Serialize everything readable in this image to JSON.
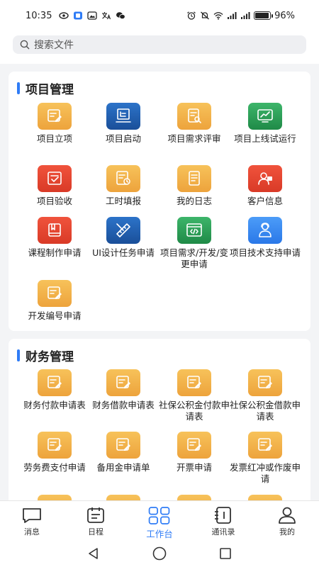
{
  "status": {
    "time": "10:35",
    "battery_text": "96%",
    "battery_level": 0.96
  },
  "search": {
    "placeholder": "搜索文件"
  },
  "sections": {
    "project": {
      "title": "项目管理",
      "items": [
        {
          "label": "项目立项",
          "icon": "form-edit-icon",
          "color": "orange"
        },
        {
          "label": "项目启动",
          "icon": "launch-board-icon",
          "color": "navy"
        },
        {
          "label": "项目需求评审",
          "icon": "document-review-icon",
          "color": "orange"
        },
        {
          "label": "项目上线试运行",
          "icon": "monitor-chart-icon",
          "color": "green"
        },
        {
          "label": "项目验收",
          "icon": "check-acceptance-icon",
          "color": "red"
        },
        {
          "label": "工时填报",
          "icon": "timesheet-icon",
          "color": "orange"
        },
        {
          "label": "我的日志",
          "icon": "log-book-icon",
          "color": "orange"
        },
        {
          "label": "客户信息",
          "icon": "customer-icon",
          "color": "red"
        },
        {
          "label": "课程制作申请",
          "icon": "course-book-icon",
          "color": "red"
        },
        {
          "label": "UI设计任务申请",
          "icon": "design-ruler-icon",
          "color": "navy"
        },
        {
          "label": "项目需求/开发/变更申请",
          "icon": "code-window-icon",
          "color": "green"
        },
        {
          "label": "项目技术支持申请",
          "icon": "support-person-icon",
          "color": "blue"
        },
        {
          "label": "开发编号申请",
          "icon": "form-edit-icon",
          "color": "orange"
        }
      ]
    },
    "finance": {
      "title": "财务管理",
      "items": [
        {
          "label": "财务付款申请表",
          "icon": "form-edit-icon",
          "color": "orange"
        },
        {
          "label": "财务借款申请表",
          "icon": "form-edit-icon",
          "color": "orange"
        },
        {
          "label": "社保公积金付款申请表",
          "icon": "form-edit-icon",
          "color": "orange"
        },
        {
          "label": "社保公积金借款申请表",
          "icon": "form-edit-icon",
          "color": "orange"
        },
        {
          "label": "劳务费支付申请",
          "icon": "form-edit-icon",
          "color": "orange"
        },
        {
          "label": "备用金申请单",
          "icon": "form-edit-icon",
          "color": "orange"
        },
        {
          "label": "开票申请",
          "icon": "form-edit-icon",
          "color": "orange"
        },
        {
          "label": "发票红冲或作废申请",
          "icon": "form-edit-icon",
          "color": "orange"
        }
      ]
    }
  },
  "tabbar": {
    "items": [
      {
        "label": "消息",
        "icon": "message-icon"
      },
      {
        "label": "日程",
        "icon": "calendar-icon"
      },
      {
        "label": "工作台",
        "icon": "workbench-icon"
      },
      {
        "label": "通讯录",
        "icon": "contacts-icon"
      },
      {
        "label": "我的",
        "icon": "profile-icon"
      }
    ],
    "active_index": 2
  },
  "colors": {
    "accent": "#2f7cf6",
    "orange": "#f0a93f",
    "navy": "#1f5fae",
    "green": "#2a9d55",
    "red": "#e5472f",
    "blue": "#3a8af3"
  }
}
